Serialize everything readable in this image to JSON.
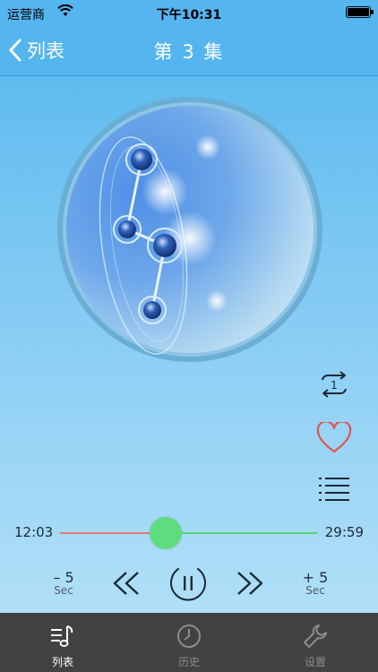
{
  "status_bar": {
    "carrier": "运营商",
    "time": "下午10:31"
  },
  "nav": {
    "back_label": "列表",
    "title": "第 3 集"
  },
  "player": {
    "current_time": "12:03",
    "total_time": "29:59",
    "progress_fraction": 0.41,
    "skip_back": {
      "amount": "– 5",
      "unit": "Sec"
    },
    "skip_forward": {
      "amount": "+ 5",
      "unit": "Sec"
    }
  },
  "tabs": [
    {
      "label": "列表",
      "icon": "music-list-icon",
      "active": true
    },
    {
      "label": "历史",
      "icon": "clock-icon",
      "active": false
    },
    {
      "label": "设置",
      "icon": "wrench-icon",
      "active": false
    }
  ],
  "colors": {
    "nav_background": "#54b5ef",
    "played_track": "#e07a6e",
    "remaining_track": "#4fd576",
    "thumb": "#5fdc7f",
    "favorite": "#e0554f",
    "tab_bar": "#404244"
  }
}
